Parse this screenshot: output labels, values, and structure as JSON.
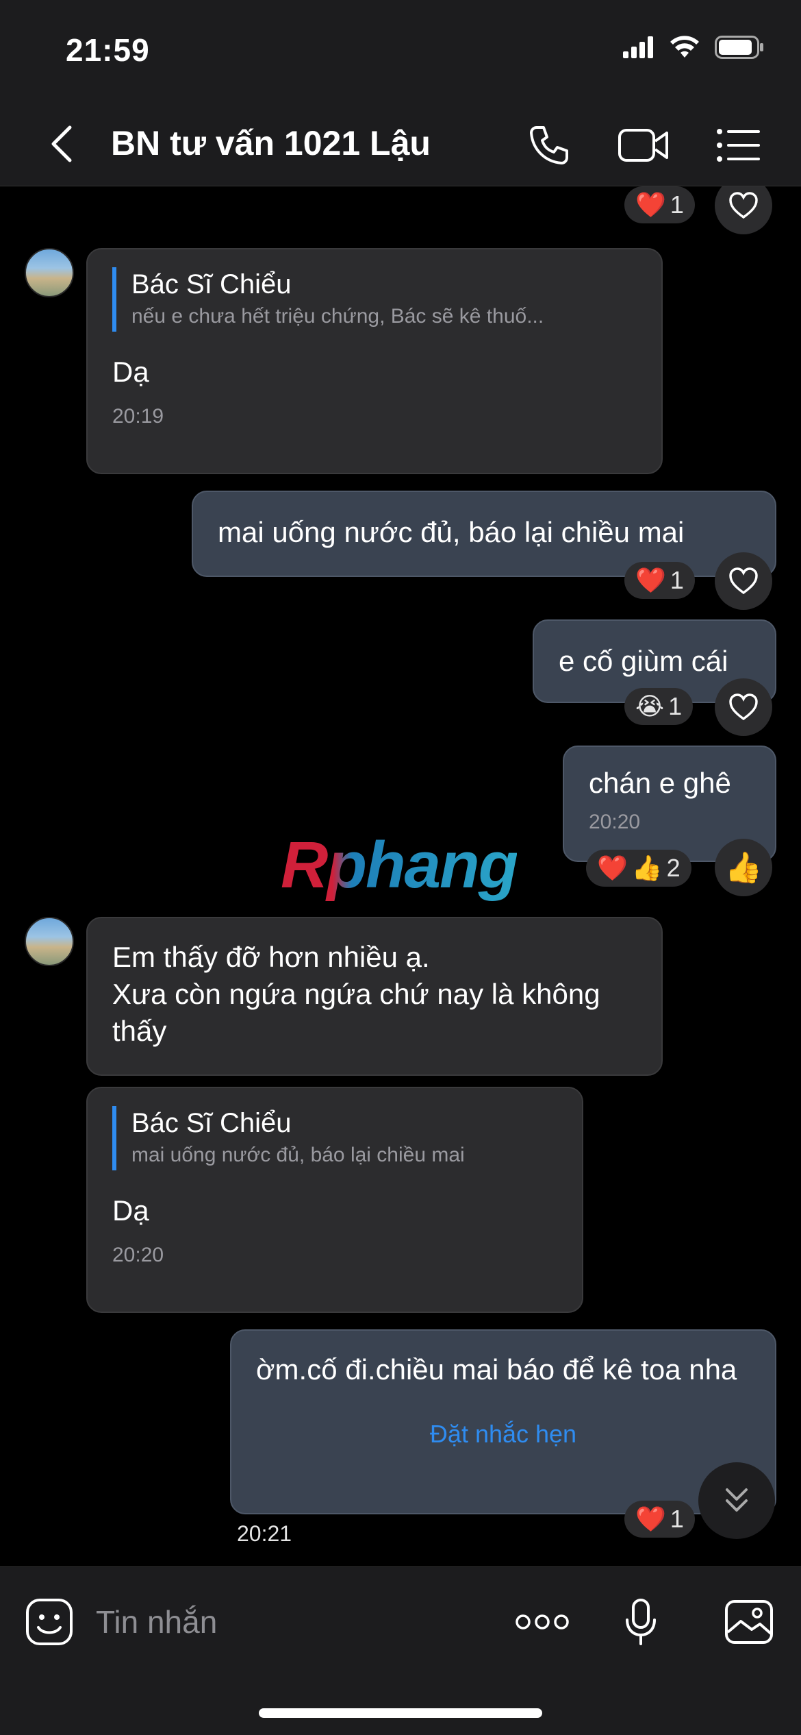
{
  "status_bar": {
    "time": "21:59"
  },
  "header": {
    "title": "BN tư vấn 1021 Lậu"
  },
  "messages": {
    "m1": {
      "reaction_count": "1"
    },
    "m2": {
      "quote_name": "Bác Sĩ Chiểu",
      "quote_text": "nếu  e chưa  hết triệu chứng, Bác sẽ kê thuố...",
      "text": "Dạ",
      "time": "20:19"
    },
    "m3": {
      "text": "mai  uống nước  đủ, báo  lại  chiều mai",
      "reaction_count": "1"
    },
    "m4": {
      "text": "e cố giùm  cái",
      "reaction_count": "1"
    },
    "m5": {
      "text": "chán e  ghê",
      "time": "20:20",
      "reaction_count": "2"
    },
    "m6": {
      "text_line1": "Em thấy đỡ hơn nhiều ạ.",
      "text_line2": "Xưa còn ngứa ngứa chứ nay là không thấy"
    },
    "m7": {
      "quote_name": "Bác Sĩ Chiểu",
      "quote_text": "mai  uống nước  đủ, báo  lại  chiều mai",
      "text": "Dạ",
      "time": "20:20"
    },
    "m8": {
      "text": "ờm.cố đi.chiều  mai báo để kê  toa nha",
      "link": "Đặt nhắc hẹn",
      "time": "20:21",
      "reaction_count": "1"
    }
  },
  "watermark": "Rphang",
  "input": {
    "placeholder": "Tin nhắn"
  },
  "colors": {
    "accent": "#2f8cf0",
    "outgoing_bubble": "#3a4351",
    "incoming_bubble": "#2c2c2e"
  }
}
